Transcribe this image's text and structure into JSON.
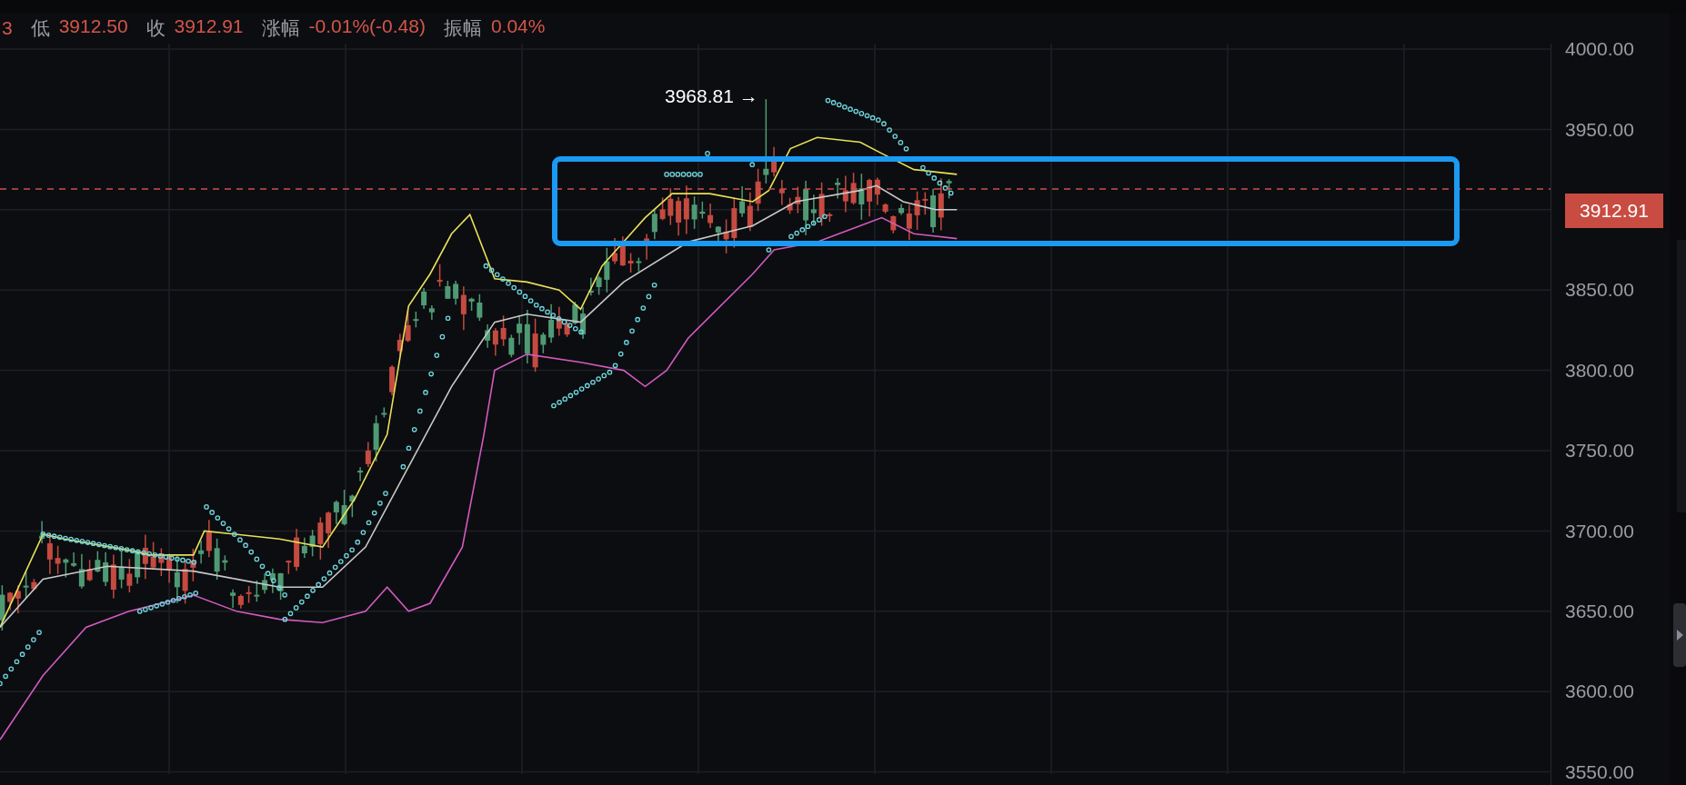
{
  "header": {
    "stats": [
      {
        "value": "3"
      },
      {
        "label": "低",
        "value": "3912.50"
      },
      {
        "label": "收",
        "value": "3912.91"
      },
      {
        "label": "涨幅",
        "value": "-0.01%(-0.48)"
      },
      {
        "label": "振幅",
        "value": "0.04%"
      }
    ]
  },
  "chart": {
    "high_annotation": "3968.81 →",
    "current_price": "3912.91",
    "price_labels_above": [
      "4000.00",
      "3950.00"
    ],
    "price_labels_below": [
      "3850.00",
      "3800.00",
      "3750.00",
      "3700.00",
      "3650.00",
      "3600.00",
      "3550.00"
    ]
  }
}
